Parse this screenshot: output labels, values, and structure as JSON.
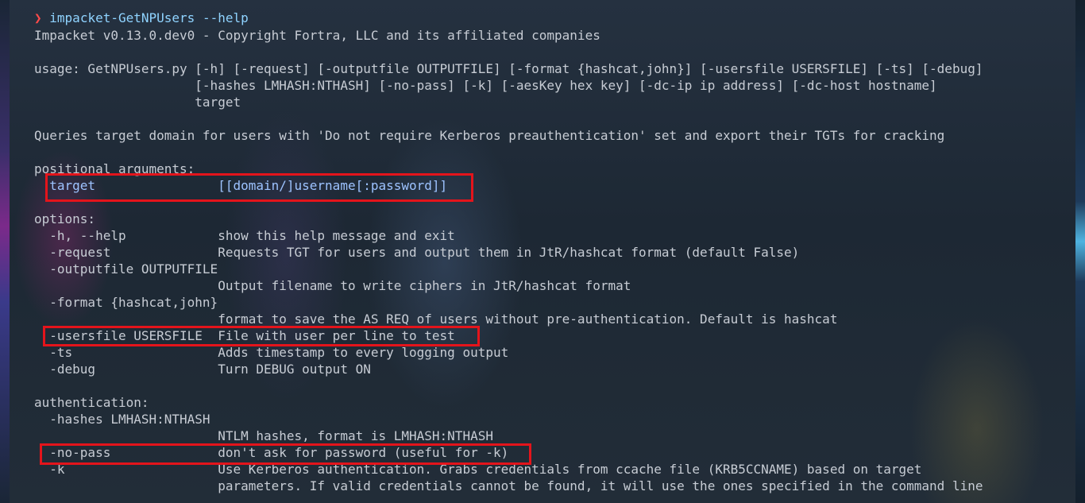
{
  "prompt": {
    "symbol": "❯",
    "command": "impacket-GetNPUsers --help"
  },
  "output": {
    "banner": "Impacket v0.13.0.dev0 - Copyright Fortra, LLC and its affiliated companies",
    "usage_1": "usage: GetNPUsers.py [-h] [-request] [-outputfile OUTPUTFILE] [-format {hashcat,john}] [-usersfile USERSFILE] [-ts] [-debug]",
    "usage_2": "                     [-hashes LMHASH:NTHASH] [-no-pass] [-k] [-aesKey hex key] [-dc-ip ip address] [-dc-host hostname]",
    "usage_3": "                     target",
    "description": "Queries target domain for users with 'Do not require Kerberos preauthentication' set and export their TGTs for cracking",
    "positional_header": "positional arguments:",
    "positional_target": "  target                [[domain/]username[:password]]",
    "options_header": "options:",
    "opt_help": "  -h, --help            show this help message and exit",
    "opt_request": "  -request              Requests TGT for users and output them in JtR/hashcat format (default False)",
    "opt_outputfile": "  -outputfile OUTPUTFILE",
    "opt_outputfile_desc": "                        Output filename to write ciphers in JtR/hashcat format",
    "opt_format": "  -format {hashcat,john}",
    "opt_format_desc": "                        format to save the AS_REQ of users without pre-authentication. Default is hashcat",
    "opt_usersfile": "  -usersfile USERSFILE  File with user per line to test",
    "opt_ts": "  -ts                   Adds timestamp to every logging output",
    "opt_debug": "  -debug                Turn DEBUG output ON",
    "auth_header": "authentication:",
    "auth_hashes": "  -hashes LMHASH:NTHASH",
    "auth_hashes_desc": "                        NTLM hashes, format is LMHASH:NTHASH",
    "auth_nopass": "  -no-pass              don't ask for password (useful for -k)",
    "auth_k": "  -k                    Use Kerberos authentication. Grabs credentials from ccache file (KRB5CCNAME) based on target",
    "auth_k_cont": "                        parameters. If valid credentials cannot be found, it will use the ones specified in the command line"
  },
  "colors": {
    "background": "#1c2733",
    "text": "#c7ccd4",
    "prompt_symbol": "#ff4a4a",
    "prompt_command": "#8fd3ff",
    "highlight_box": "#e4141b"
  }
}
